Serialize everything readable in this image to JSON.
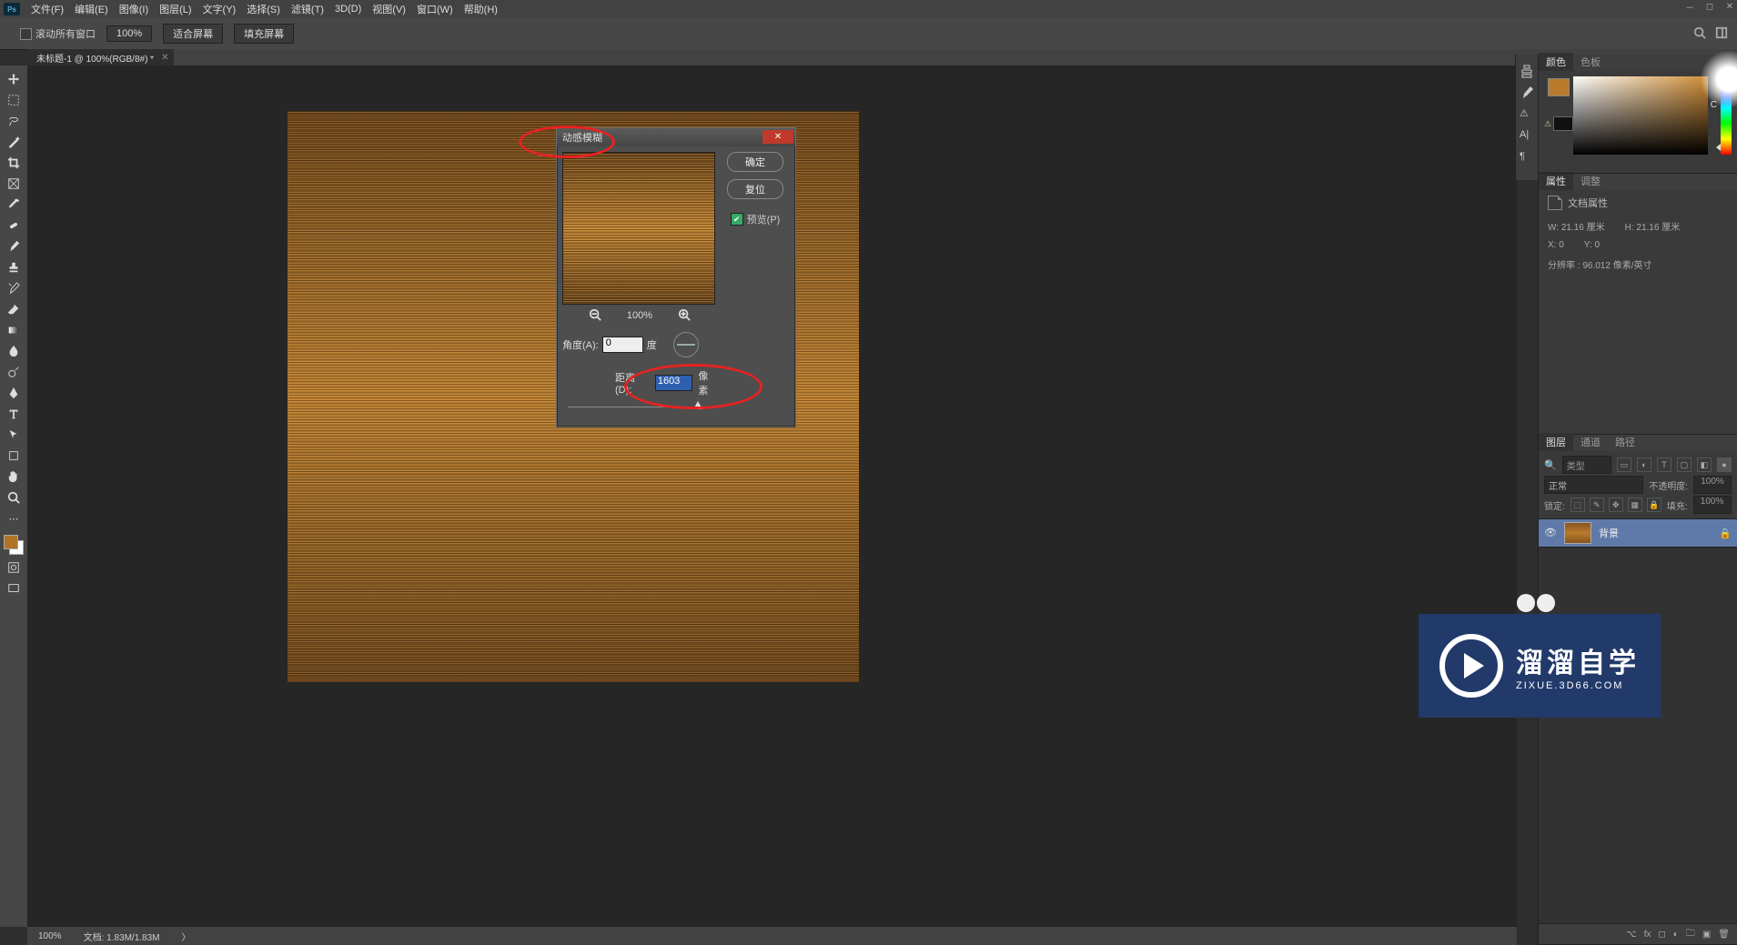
{
  "menubar": {
    "items": [
      "文件(F)",
      "编辑(E)",
      "图像(I)",
      "图层(L)",
      "文字(Y)",
      "选择(S)",
      "滤镜(T)",
      "3D(D)",
      "视图(V)",
      "窗口(W)",
      "帮助(H)"
    ]
  },
  "options": {
    "scroll_all": "滚动所有窗口",
    "zoom": "100%",
    "fit": "适合屏幕",
    "fill": "填充屏幕"
  },
  "doctab": {
    "title": "未标题-1 @ 100%(RGB/8#) *"
  },
  "dialog": {
    "title": "动感模糊",
    "ok": "确定",
    "reset": "复位",
    "preview": "预览(P)",
    "zoom": "100%",
    "angle_label": "角度(A):",
    "angle_value": "0",
    "angle_unit": "度",
    "dist_label": "距离(D):",
    "dist_value": "1603",
    "dist_unit": "像素"
  },
  "right": {
    "color_tab": "颜色",
    "swatches_tab": "色板",
    "props_tab": "属性",
    "adjust_tab": "调整",
    "doc_props": "文档属性",
    "w": "W:  21.16 厘米",
    "h": "H:  21.16 厘米",
    "x": "X:  0",
    "y": "Y:  0",
    "res": "分辨率 : 96.012 像素/英寸",
    "layers_tab": "图层",
    "channels_tab": "通道",
    "paths_tab": "路径",
    "kind": "类型",
    "blend": "正常",
    "opacity_label": "不透明度:",
    "opacity": "100%",
    "lock_label": "锁定:",
    "fill_label": "填充:",
    "fill": "100%",
    "layer_name": "背景"
  },
  "status": {
    "zoom": "100%",
    "doc": "文档: 1.83M/1.83M"
  },
  "watermark": {
    "big": "溜溜自学",
    "small": "ZIXUE.3D66.COM"
  },
  "color_picker": {
    "channel": "C"
  }
}
